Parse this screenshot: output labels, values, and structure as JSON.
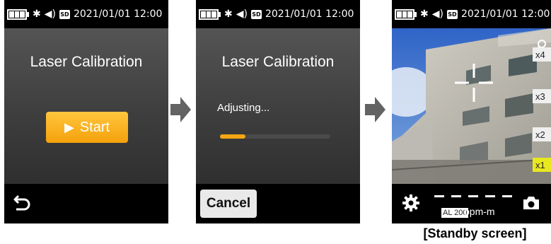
{
  "status_bar": {
    "datetime": "2021/01/01 12:00",
    "icons": [
      "battery-icon",
      "bluetooth-icon",
      "volume-icon",
      "sd-card-icon"
    ],
    "sd_label": "SD"
  },
  "screen1": {
    "title": "Laser Calibration",
    "start_label": "Start",
    "back_icon": "back-icon"
  },
  "screen2": {
    "title": "Laser Calibration",
    "adjusting_label": "Adjusting...",
    "progress": 0.23,
    "cancel_label": "Cancel"
  },
  "screen3": {
    "zoom_levels": [
      "x4",
      "x3",
      "x2",
      "x1"
    ],
    "active_zoom": "x1",
    "reading": "- - - - -",
    "al_label": "AL 200",
    "unit": "ppm-m",
    "icons": [
      "zoom-icon",
      "gear-icon",
      "camera-icon",
      "crosshair-icon"
    ]
  },
  "caption": "[Standby screen]",
  "colors": {
    "accent_orange": "#f6a613",
    "zoom_active": "#e8e81f",
    "bar_black": "#000000"
  }
}
